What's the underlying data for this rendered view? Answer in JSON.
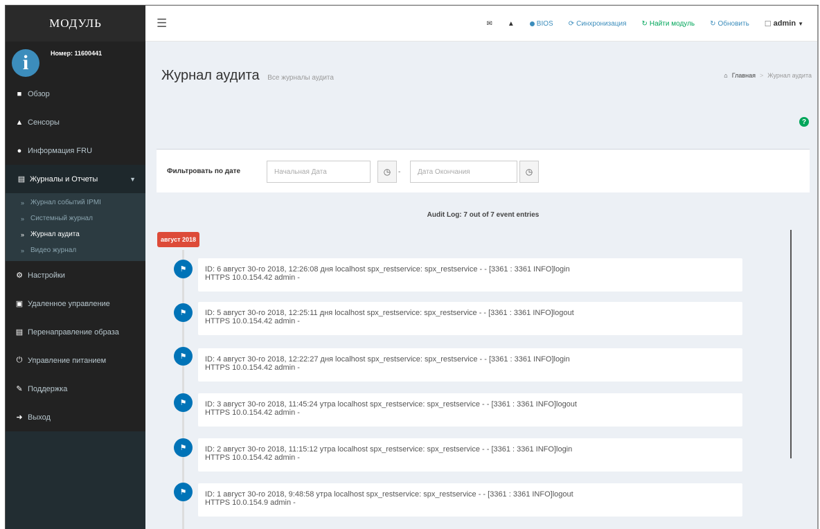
{
  "sidebar": {
    "brand": "МОДУЛЬ",
    "user": {
      "avatar_letter": "i",
      "number": "Номер: 11600441"
    },
    "items": [
      {
        "label": "Обзор",
        "icon": "dashboard-icon"
      },
      {
        "label": "Сенсоры",
        "icon": "car-icon"
      },
      {
        "label": "Информация FRU",
        "icon": "info-icon"
      },
      {
        "label": "Журналы и Отчеты",
        "icon": "chart-icon"
      }
    ],
    "subitems": [
      "Журнал событий IPMI",
      "Системный журнал",
      "Журнал аудита",
      "Видео журнал"
    ],
    "items_after": [
      {
        "label": "Настройки",
        "icon": "gear-icon"
      },
      {
        "label": "Удаленное управление",
        "icon": "monitor-icon"
      },
      {
        "label": "Перенаправление образа",
        "icon": "image-redirect-icon"
      },
      {
        "label": "Управление питанием",
        "icon": "power-icon"
      },
      {
        "label": "Поддержка",
        "icon": "wrench-icon"
      },
      {
        "label": "Выход",
        "icon": "sign-out-icon"
      }
    ]
  },
  "topbar": {
    "bios": "BIOS",
    "sync": "Синхронизация",
    "find_module": "Найти модуль",
    "refresh": "Обновить",
    "user": "admin"
  },
  "header": {
    "title": "Журнал аудита",
    "subtitle": "Все журналы аудита",
    "breadcrumb_home": "Главная",
    "breadcrumb_current": "Журнал аудита"
  },
  "filter": {
    "label": "Фильтровать по дате",
    "start_placeholder": "Начальная Дата",
    "end_placeholder": "Дата Окончания",
    "separator": "-"
  },
  "log": {
    "count_text": "Audit Log: 7 out of 7 event entries",
    "time_label": "август 2018",
    "entries": [
      {
        "line1": "ID: 6 август 30-го 2018, 12:26:08 дня   localhost   spx_restservice: spx_restservice - - [3361 : 3361 INFO]login",
        "line2": "HTTPS 10.0.154.42 admin -"
      },
      {
        "line1": "ID: 5 август 30-го 2018, 12:25:11 дня   localhost   spx_restservice: spx_restservice - - [3361 : 3361 INFO]logout",
        "line2": "HTTPS 10.0.154.42 admin -"
      },
      {
        "line1": "ID: 4 август 30-го 2018, 12:22:27 дня   localhost   spx_restservice: spx_restservice - - [3361 : 3361 INFO]login",
        "line2": "HTTPS 10.0.154.42 admin -"
      },
      {
        "line1": "ID: 3 август 30-го 2018, 11:45:24 утра   localhost   spx_restservice: spx_restservice - - [3361 : 3361 INFO]logout",
        "line2": "HTTPS 10.0.154.42 admin -"
      },
      {
        "line1": "ID: 2 август 30-го 2018, 11:15:12 утра   localhost   spx_restservice: spx_restservice - - [3361 : 3361 INFO]login",
        "line2": "HTTPS 10.0.154.42 admin -"
      },
      {
        "line1": "ID: 1 август 30-го 2018, 9:48:58 утра   localhost   spx_restservice: spx_restservice - - [3361 : 3361 INFO]logout",
        "line2": "HTTPS 10.0.154.9 admin -"
      }
    ]
  },
  "colors": {
    "accent": "#3c8dbc",
    "sidebar_bg": "#222d32",
    "time_label_bg": "#dd4b39",
    "entry_icon_bg": "#0073b7",
    "help_icon": "#00a65a"
  }
}
